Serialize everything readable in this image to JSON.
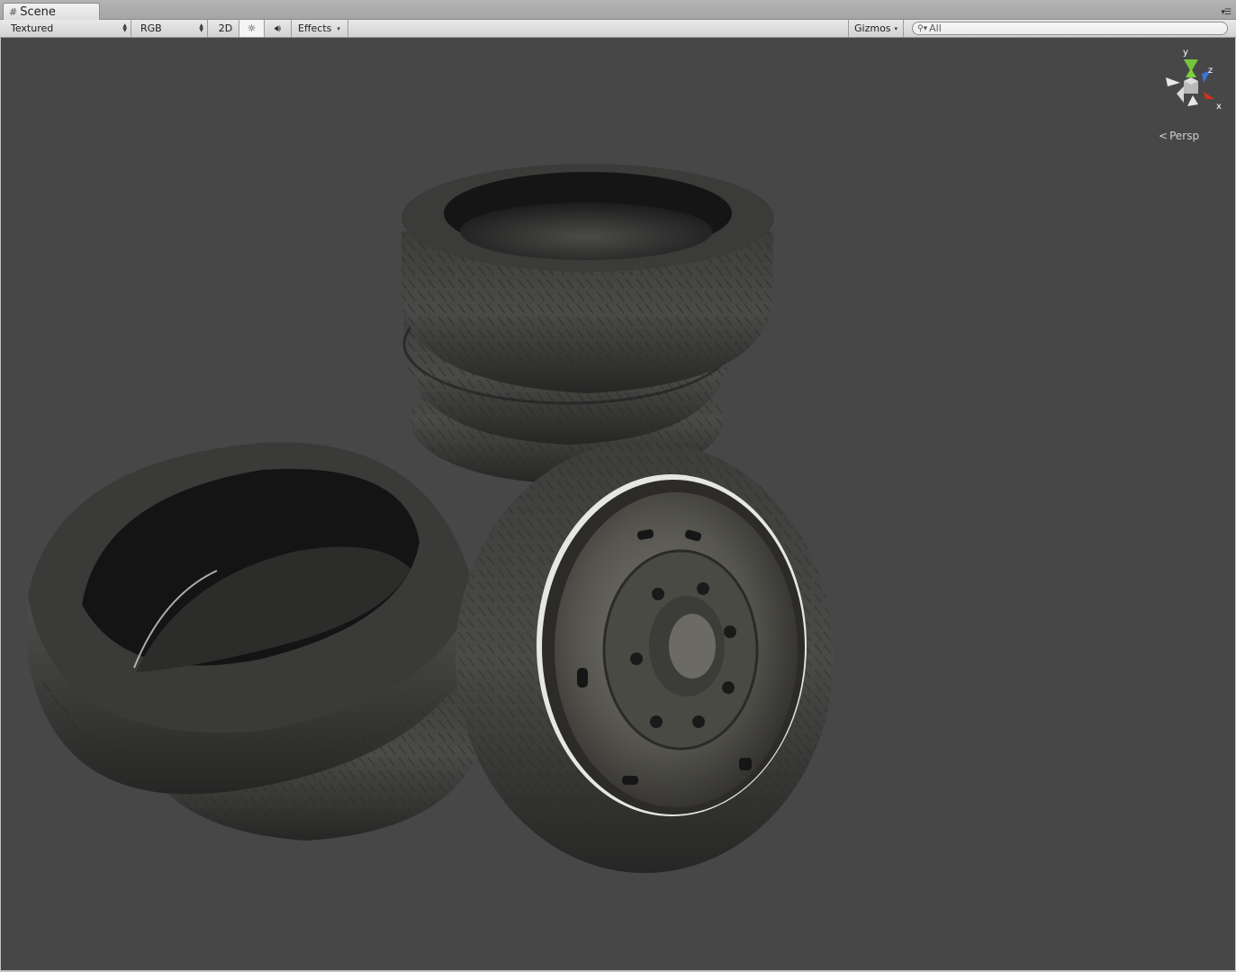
{
  "tab": {
    "title": "Scene",
    "icon": "grid-icon",
    "menu_icon": "tab-menu-icon"
  },
  "toolbar": {
    "draw_mode": "Textured",
    "render_mode": "RGB",
    "mode_2d": "2D",
    "lighting_icon": "sun-icon",
    "audio_icon": "speaker-icon",
    "effects": "Effects",
    "gizmos": "Gizmos"
  },
  "search": {
    "placeholder": "All",
    "icon": "search-icon"
  },
  "viewport": {
    "background": "#474747",
    "projection": "Persp",
    "axes": {
      "y": "y",
      "z": "z",
      "x": "x"
    },
    "axis_colors": {
      "y": "#7bd13a",
      "z": "#3c73d6",
      "x": "#d2331f"
    },
    "objects": [
      "tire-stack",
      "tire-pile",
      "wheel-with-steel-rim"
    ]
  }
}
